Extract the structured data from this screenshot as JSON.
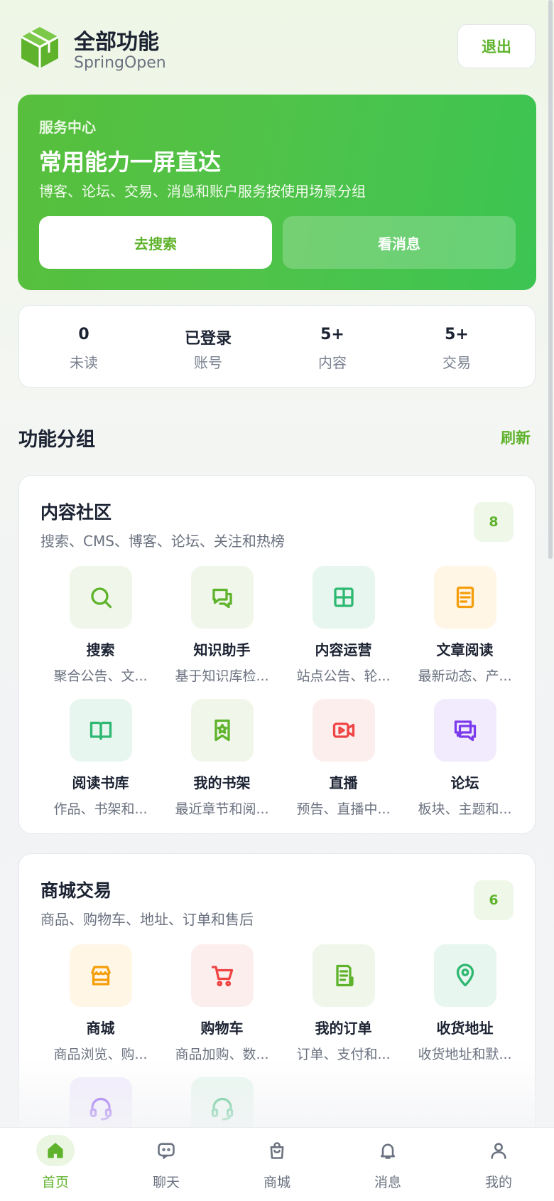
{
  "header": {
    "title": "全部功能",
    "subtitle": "SpringOpen",
    "logout_label": "退出"
  },
  "hero": {
    "kicker": "服务中心",
    "title": "常用能力一屏直达",
    "description": "博客、论坛、交易、消息和账户服务按使用场景分组",
    "search_button": "去搜索",
    "message_button": "看消息"
  },
  "stats": [
    {
      "value": "0",
      "label": "未读"
    },
    {
      "value": "已登录",
      "label": "账号"
    },
    {
      "value": "5+",
      "label": "内容"
    },
    {
      "value": "5+",
      "label": "交易"
    }
  ],
  "section": {
    "title": "功能分组",
    "refresh_label": "刷新"
  },
  "groups": [
    {
      "title": "内容社区",
      "description": "搜索、CMS、博客、论坛、关注和热榜",
      "count": "8",
      "items": [
        {
          "name": "搜索",
          "desc": "聚合公告、文...",
          "icon": "search-icon",
          "color": "#5fb32c",
          "bg": "#f0f7ea"
        },
        {
          "name": "知识助手",
          "desc": "基于知识库检...",
          "icon": "chat-icon",
          "color": "#5fb32c",
          "bg": "#f0f7ea"
        },
        {
          "name": "内容运营",
          "desc": "站点公告、轮...",
          "icon": "grid-icon",
          "color": "#2eb872",
          "bg": "#e7f6ee"
        },
        {
          "name": "文章阅读",
          "desc": "最新动态、产...",
          "icon": "article-icon",
          "color": "#f59e0b",
          "bg": "#fff6e6"
        },
        {
          "name": "阅读书库",
          "desc": "作品、书架和...",
          "icon": "book-icon",
          "color": "#2eb872",
          "bg": "#e7f6ee"
        },
        {
          "name": "我的书架",
          "desc": "最近章节和阅...",
          "icon": "bookmark-star-icon",
          "color": "#5fb32c",
          "bg": "#f0f7ea"
        },
        {
          "name": "直播",
          "desc": "预告、直播中...",
          "icon": "video-icon",
          "color": "#ef4444",
          "bg": "#fdeeee"
        },
        {
          "name": "论坛",
          "desc": "板块、主题和...",
          "icon": "forum-icon",
          "color": "#7c3aed",
          "bg": "#f1ebfd"
        }
      ]
    },
    {
      "title": "商城交易",
      "description": "商品、购物车、地址、订单和售后",
      "count": "6",
      "items": [
        {
          "name": "商城",
          "desc": "商品浏览、购...",
          "icon": "store-icon",
          "color": "#f59e0b",
          "bg": "#fff6e6"
        },
        {
          "name": "购物车",
          "desc": "商品加购、数...",
          "icon": "cart-icon",
          "color": "#ef4444",
          "bg": "#fdeeee"
        },
        {
          "name": "我的订单",
          "desc": "订单、支付和...",
          "icon": "receipt-icon",
          "color": "#5fb32c",
          "bg": "#f0f7ea"
        },
        {
          "name": "收货地址",
          "desc": "收货地址和默...",
          "icon": "location-pin-icon",
          "color": "#2eb872",
          "bg": "#e7f6ee"
        },
        {
          "name": "",
          "desc": "",
          "icon": "headset-icon",
          "color": "#7c3aed",
          "bg": "#f1ebfd"
        },
        {
          "name": "",
          "desc": "",
          "icon": "headset-icon",
          "color": "#2eb872",
          "bg": "#e7f6ee"
        }
      ]
    }
  ],
  "tabbar": [
    {
      "label": "首页",
      "icon": "home-icon",
      "active": true
    },
    {
      "label": "聊天",
      "icon": "chat-bubble-icon",
      "active": false
    },
    {
      "label": "商城",
      "icon": "shopping-bag-icon",
      "active": false
    },
    {
      "label": "消息",
      "icon": "bell-icon",
      "active": false
    },
    {
      "label": "我的",
      "icon": "user-icon",
      "active": false
    }
  ],
  "colors": {
    "accent": "#5fb32c",
    "hero_start": "#57bf3c",
    "hero_end": "#3cc452"
  }
}
